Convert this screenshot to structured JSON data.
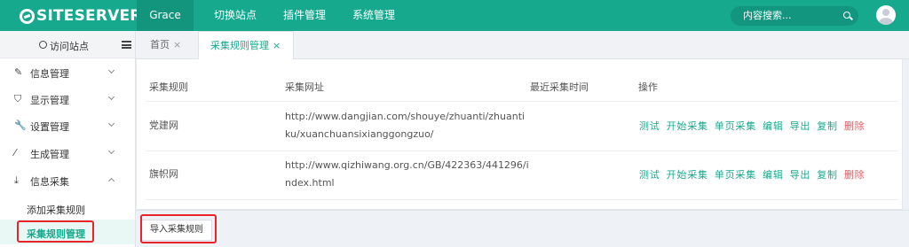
{
  "logo": "SITESERVER",
  "nav": [
    "Grace",
    "切换站点",
    "插件管理",
    "系统管理"
  ],
  "search": {
    "placeholder": "内容搜索..."
  },
  "sidebar": {
    "visit_site": "访问站点",
    "menu": [
      {
        "label": "信息管理",
        "icon": "edit-icon"
      },
      {
        "label": "显示管理",
        "icon": "shirt-icon"
      },
      {
        "label": "设置管理",
        "icon": "wrench-icon"
      },
      {
        "label": "生成管理",
        "icon": "magic-wand-icon"
      },
      {
        "label": "信息采集",
        "icon": "download-icon"
      }
    ],
    "sub_items": [
      "添加采集规则",
      "采集规则管理"
    ]
  },
  "tabs": [
    {
      "label": "首页",
      "close": "×"
    },
    {
      "label": "采集规则管理",
      "close": "×"
    }
  ],
  "table": {
    "headers": [
      "采集规则",
      "采集网址",
      "最近采集时间",
      "操作"
    ],
    "rows": [
      {
        "name": "党建网",
        "url_line1": "http://www.dangjian.com/shouye/zhuanti/zhuanti",
        "url_line2": "ku/xuanchuansixianggongzuo/",
        "last_time": ""
      },
      {
        "name": "旗帜网",
        "url_line1": "http://www.qizhiwang.org.cn/GB/422363/441296/i",
        "url_line2": "ndex.html",
        "last_time": ""
      }
    ],
    "actions": [
      "测试",
      "开始采集",
      "单页采集",
      "编辑",
      "导出",
      "复制",
      "删除"
    ]
  },
  "import_button": "导入采集规则",
  "colors": {
    "accent": "#17a98e",
    "danger": "#f0555a",
    "highlight": "#e8232a"
  }
}
